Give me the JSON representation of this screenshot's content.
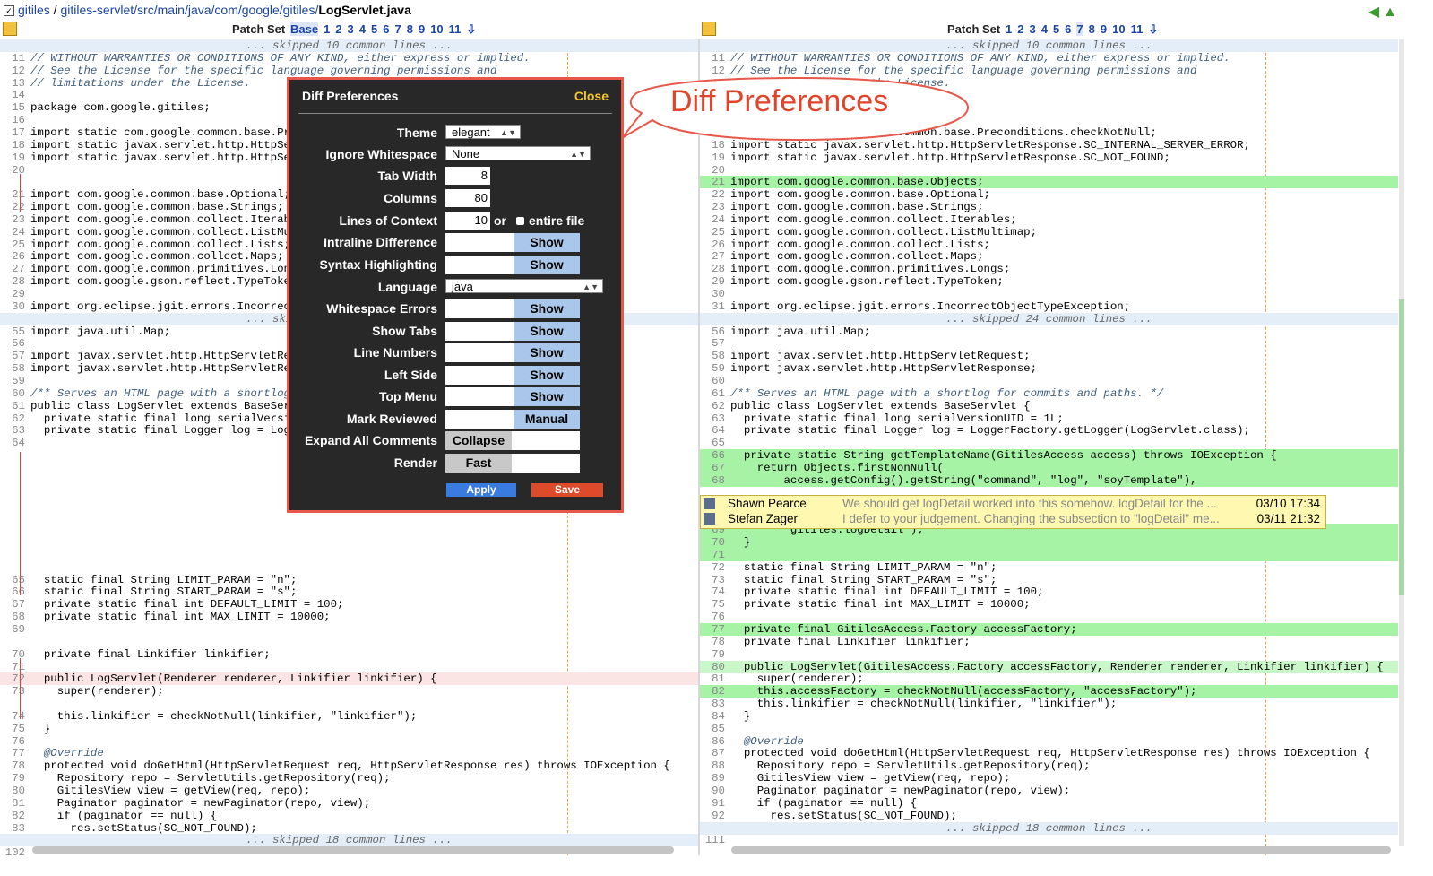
{
  "breadcrumb": {
    "project": "gitiles",
    "sep": " / ",
    "path": "gitiles-servlet/src/main/java/com/google/gitiles/",
    "file": "LogServlet.java"
  },
  "patchset_left": {
    "label": "Patch Set",
    "items": [
      "Base",
      "1",
      "2",
      "3",
      "4",
      "5",
      "6",
      "7",
      "8",
      "9",
      "10",
      "11"
    ],
    "current": "Base"
  },
  "patchset_right": {
    "label": "Patch Set",
    "items": [
      "1",
      "2",
      "3",
      "4",
      "5",
      "6",
      "7",
      "8",
      "9",
      "10",
      "11"
    ],
    "current": "7"
  },
  "left_lines": [
    {
      "t": "skip",
      "code": "... skipped 10 common lines ..."
    },
    {
      "n": "11",
      "code": "// WITHOUT WARRANTIES OR CONDITIONS OF ANY KIND, either express or implied.",
      "c": "cm"
    },
    {
      "n": "12",
      "code": "// See the License for the specific language governing permissions and",
      "c": "cm"
    },
    {
      "n": "13",
      "code": "// limitations under the License.",
      "c": "cm"
    },
    {
      "n": "14",
      "code": ""
    },
    {
      "n": "15",
      "code": "package com.google.gitiles;"
    },
    {
      "n": "16",
      "code": ""
    },
    {
      "n": "17",
      "code": "import static com.google.common.base.Preconditions.checkNotNull;"
    },
    {
      "n": "18",
      "code": "import static javax.servlet.http.HttpServletResponse.SC_INTERNAL_SERVER_ERROR;"
    },
    {
      "n": "19",
      "code": "import static javax.servlet.http.HttpServletResponse.SC_NOT_FOUND;"
    },
    {
      "n": "20",
      "code": ""
    },
    {
      "n": "",
      "code": ""
    },
    {
      "n": "21",
      "code": "import com.google.common.base.Optional;"
    },
    {
      "n": "22",
      "code": "import com.google.common.base.Strings;"
    },
    {
      "n": "23",
      "code": "import com.google.common.collect.Iterables;"
    },
    {
      "n": "24",
      "code": "import com.google.common.collect.ListMultimap;"
    },
    {
      "n": "25",
      "code": "import com.google.common.collect.Lists;"
    },
    {
      "n": "26",
      "code": "import com.google.common.collect.Maps;"
    },
    {
      "n": "27",
      "code": "import com.google.common.primitives.Longs;"
    },
    {
      "n": "28",
      "code": "import com.google.gson.reflect.TypeToken;"
    },
    {
      "n": "29",
      "code": ""
    },
    {
      "n": "30",
      "code": "import org.eclipse.jgit.errors.IncorrectObjectTypeException;"
    },
    {
      "t": "skip",
      "code": "... skipped 24 common lines ..."
    },
    {
      "n": "55",
      "code": "import java.util.Map;"
    },
    {
      "n": "56",
      "code": ""
    },
    {
      "n": "57",
      "code": "import javax.servlet.http.HttpServletRequest;"
    },
    {
      "n": "58",
      "code": "import javax.servlet.http.HttpServletResponse;"
    },
    {
      "n": "59",
      "code": ""
    },
    {
      "n": "60",
      "code": "/** Serves an HTML page with a shortlog for commits and paths. */",
      "c": "cm"
    },
    {
      "n": "61",
      "code": "public class LogServlet extends BaseServlet {"
    },
    {
      "n": "62",
      "code": "  private static final long serialVersionUID = 1L;"
    },
    {
      "n": "63",
      "code": "  private static final Logger log = LoggerFactory.getLogger(LogServlet.class);"
    },
    {
      "n": "64",
      "code": ""
    },
    {
      "n": "",
      "code": ""
    },
    {
      "n": "",
      "code": ""
    },
    {
      "n": "",
      "code": ""
    },
    {
      "n": "",
      "code": ""
    },
    {
      "n": "",
      "code": ""
    },
    {
      "n": "",
      "code": ""
    },
    {
      "n": "",
      "code": ""
    },
    {
      "n": "",
      "code": ""
    },
    {
      "n": "",
      "code": ""
    },
    {
      "n": "",
      "code": ""
    },
    {
      "n": "65",
      "code": "  static final String LIMIT_PARAM = \"n\";"
    },
    {
      "n": "66",
      "code": "  static final String START_PARAM = \"s\";"
    },
    {
      "n": "67",
      "code": "  private static final int DEFAULT_LIMIT = 100;"
    },
    {
      "n": "68",
      "code": "  private static final int MAX_LIMIT = 10000;"
    },
    {
      "n": "69",
      "code": ""
    },
    {
      "n": "",
      "code": ""
    },
    {
      "n": "70",
      "code": "  private final Linkifier linkifier;"
    },
    {
      "n": "71",
      "code": ""
    },
    {
      "n": "72",
      "code": "  public LogServlet(Renderer renderer, Linkifier linkifier) {",
      "t": "del"
    },
    {
      "n": "73",
      "code": "    super(renderer);"
    },
    {
      "n": "",
      "code": ""
    },
    {
      "n": "74",
      "code": "    this.linkifier = checkNotNull(linkifier, \"linkifier\");"
    },
    {
      "n": "75",
      "code": "  }"
    },
    {
      "n": "76",
      "code": ""
    },
    {
      "n": "77",
      "code": "  @Override",
      "c": "cm"
    },
    {
      "n": "78",
      "code": "  protected void doGetHtml(HttpServletRequest req, HttpServletResponse res) throws IOException {"
    },
    {
      "n": "79",
      "code": "    Repository repo = ServletUtils.getRepository(req);"
    },
    {
      "n": "80",
      "code": "    GitilesView view = getView(req, repo);"
    },
    {
      "n": "81",
      "code": "    Paginator paginator = newPaginator(repo, view);"
    },
    {
      "n": "82",
      "code": "    if (paginator == null) {"
    },
    {
      "n": "83",
      "code": "      res.setStatus(SC_NOT_FOUND);"
    },
    {
      "t": "skip",
      "code": "... skipped 18 common lines ..."
    },
    {
      "n": "102",
      "code": ""
    }
  ],
  "right_lines": [
    {
      "t": "skip",
      "code": "... skipped 10 common lines ..."
    },
    {
      "n": "11",
      "code": "// WITHOUT WARRANTIES OR CONDITIONS OF ANY KIND, either express or implied.",
      "c": "cm"
    },
    {
      "n": "12",
      "code": "// See the License for the specific language governing permissions and",
      "c": "cm"
    },
    {
      "n": "13",
      "code": "// limitations under the License.",
      "c": "cm"
    },
    {
      "n": "14",
      "code": ""
    },
    {
      "n": "15",
      "code": "package com.google.gitiles;"
    },
    {
      "n": "16",
      "code": ""
    },
    {
      "n": "17",
      "code": "import static com.google.common.base.Preconditions.checkNotNull;"
    },
    {
      "n": "18",
      "code": "import static javax.servlet.http.HttpServletResponse.SC_INTERNAL_SERVER_ERROR;"
    },
    {
      "n": "19",
      "code": "import static javax.servlet.http.HttpServletResponse.SC_NOT_FOUND;"
    },
    {
      "n": "20",
      "code": ""
    },
    {
      "n": "21",
      "code": "import com.google.common.base.Objects;",
      "t": "ins"
    },
    {
      "n": "22",
      "code": "import com.google.common.base.Optional;"
    },
    {
      "n": "23",
      "code": "import com.google.common.base.Strings;"
    },
    {
      "n": "24",
      "code": "import com.google.common.collect.Iterables;"
    },
    {
      "n": "25",
      "code": "import com.google.common.collect.ListMultimap;"
    },
    {
      "n": "26",
      "code": "import com.google.common.collect.Lists;"
    },
    {
      "n": "27",
      "code": "import com.google.common.collect.Maps;"
    },
    {
      "n": "28",
      "code": "import com.google.common.primitives.Longs;"
    },
    {
      "n": "29",
      "code": "import com.google.gson.reflect.TypeToken;"
    },
    {
      "n": "30",
      "code": ""
    },
    {
      "n": "31",
      "code": "import org.eclipse.jgit.errors.IncorrectObjectTypeException;"
    },
    {
      "t": "skip",
      "code": "... skipped 24 common lines ..."
    },
    {
      "n": "56",
      "code": "import java.util.Map;"
    },
    {
      "n": "57",
      "code": ""
    },
    {
      "n": "58",
      "code": "import javax.servlet.http.HttpServletRequest;"
    },
    {
      "n": "59",
      "code": "import javax.servlet.http.HttpServletResponse;"
    },
    {
      "n": "60",
      "code": ""
    },
    {
      "n": "61",
      "code": "/** Serves an HTML page with a shortlog for commits and paths. */",
      "c": "cm"
    },
    {
      "n": "62",
      "code": "public class LogServlet extends BaseServlet {"
    },
    {
      "n": "63",
      "code": "  private static final long serialVersionUID = 1L;"
    },
    {
      "n": "64",
      "code": "  private static final Logger log = LoggerFactory.getLogger(LogServlet.class);"
    },
    {
      "n": "65",
      "code": ""
    },
    {
      "n": "66",
      "code": "  private static String getTemplateName(GitilesAccess access) throws IOException {",
      "t": "ins"
    },
    {
      "n": "67",
      "code": "    return Objects.firstNonNull(",
      "t": "ins"
    },
    {
      "n": "68",
      "code": "        access.getConfig().getString(\"command\", \"log\", \"soyTemplate\"),",
      "t": "ins"
    },
    {
      "n": "",
      "code": "",
      "t": "gap"
    },
    {
      "n": "",
      "code": "",
      "t": "gap"
    },
    {
      "n": "",
      "code": "",
      "t": "gap"
    },
    {
      "n": "69",
      "code": "        \"gitiles.logDetail\");",
      "t": "ins"
    },
    {
      "n": "70",
      "code": "  }",
      "t": "ins"
    },
    {
      "n": "71",
      "code": "",
      "t": "ins"
    },
    {
      "n": "72",
      "code": "  static final String LIMIT_PARAM = \"n\";"
    },
    {
      "n": "73",
      "code": "  static final String START_PARAM = \"s\";"
    },
    {
      "n": "74",
      "code": "  private static final int DEFAULT_LIMIT = 100;"
    },
    {
      "n": "75",
      "code": "  private static final int MAX_LIMIT = 10000;"
    },
    {
      "n": "76",
      "code": ""
    },
    {
      "n": "77",
      "code": "  private final GitilesAccess.Factory accessFactory;",
      "t": "ins"
    },
    {
      "n": "78",
      "code": "  private final Linkifier linkifier;"
    },
    {
      "n": "79",
      "code": ""
    },
    {
      "n": "80",
      "code": "  public LogServlet(GitilesAccess.Factory accessFactory, Renderer renderer, Linkifier linkifier) {",
      "t": "hl"
    },
    {
      "n": "81",
      "code": "    super(renderer);"
    },
    {
      "n": "82",
      "code": "    this.accessFactory = checkNotNull(accessFactory, \"accessFactory\");",
      "t": "ins"
    },
    {
      "n": "83",
      "code": "    this.linkifier = checkNotNull(linkifier, \"linkifier\");"
    },
    {
      "n": "84",
      "code": "  }"
    },
    {
      "n": "85",
      "code": ""
    },
    {
      "n": "86",
      "code": "  @Override",
      "c": "cm"
    },
    {
      "n": "87",
      "code": "  protected void doGetHtml(HttpServletRequest req, HttpServletResponse res) throws IOException {"
    },
    {
      "n": "88",
      "code": "    Repository repo = ServletUtils.getRepository(req);"
    },
    {
      "n": "89",
      "code": "    GitilesView view = getView(req, repo);"
    },
    {
      "n": "90",
      "code": "    Paginator paginator = newPaginator(repo, view);"
    },
    {
      "n": "91",
      "code": "    if (paginator == null) {"
    },
    {
      "n": "92",
      "code": "      res.setStatus(SC_NOT_FOUND);"
    },
    {
      "t": "skip",
      "code": "... skipped 18 common lines ..."
    },
    {
      "n": "111",
      "code": ""
    }
  ],
  "comments": [
    {
      "author": "Shawn Pearce",
      "message": "We should get logDetail worked into this somehow. logDetail for the ...",
      "time": "03/10 17:34"
    },
    {
      "author": "Stefan Zager",
      "message": "I defer to your judgement. Changing the subsection to \"logDetail\" me...",
      "time": "03/11 21:32"
    }
  ],
  "dialog": {
    "title": "Diff Preferences",
    "close": "Close",
    "theme": {
      "label": "Theme",
      "value": "elegant"
    },
    "ignore_whitespace": {
      "label": "Ignore Whitespace",
      "value": "None"
    },
    "tab_width": {
      "label": "Tab Width",
      "value": "8"
    },
    "columns": {
      "label": "Columns",
      "value": "80"
    },
    "context": {
      "label": "Lines of Context",
      "value": "10",
      "or": "or",
      "entire": "entire file"
    },
    "intraline": {
      "label": "Intraline Difference",
      "state": "Show"
    },
    "syntax": {
      "label": "Syntax Highlighting",
      "state": "Show"
    },
    "language": {
      "label": "Language",
      "value": "java"
    },
    "whitespace_errors": {
      "label": "Whitespace Errors",
      "state": "Show"
    },
    "show_tabs": {
      "label": "Show Tabs",
      "state": "Show"
    },
    "line_numbers": {
      "label": "Line Numbers",
      "state": "Show"
    },
    "left_side": {
      "label": "Left Side",
      "state": "Show"
    },
    "top_menu": {
      "label": "Top Menu",
      "state": "Show"
    },
    "mark_reviewed": {
      "label": "Mark Reviewed",
      "state": "Manual"
    },
    "expand_comments": {
      "label": "Expand All Comments",
      "state": "Collapse"
    },
    "render": {
      "label": "Render",
      "state": "Fast"
    },
    "apply": "Apply",
    "save": "Save"
  },
  "callout": "Diff Preferences",
  "colors": {
    "insert": "#a6f3a6",
    "accent": "#e8584a",
    "dialog_bg": "#282828",
    "toggle_on": "#a9c7ea",
    "comment_bg": "#fff8b0"
  }
}
